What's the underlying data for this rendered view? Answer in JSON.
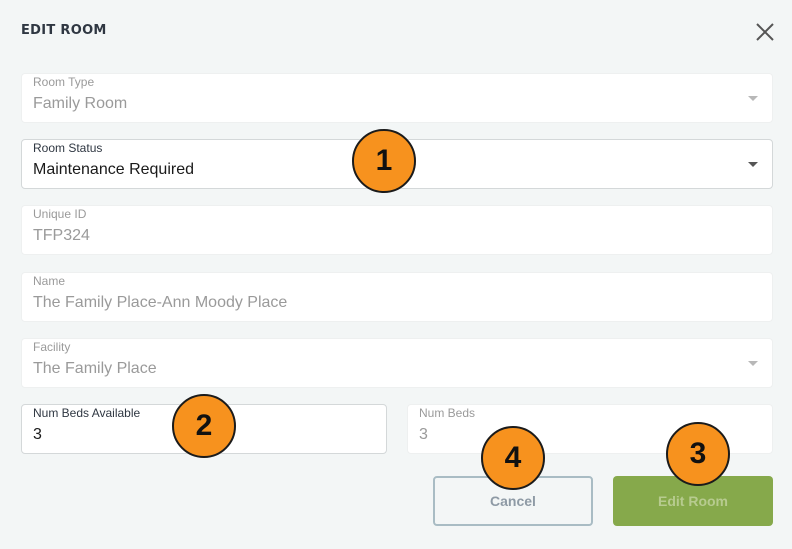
{
  "dialog": {
    "title": "EDIT ROOM",
    "close_icon": "close-icon"
  },
  "fields": {
    "room_type": {
      "label": "Room Type",
      "value": "Family Room"
    },
    "room_status": {
      "label": "Room Status",
      "value": "Maintenance Required"
    },
    "unique_id": {
      "label": "Unique ID",
      "value": "TFP324"
    },
    "name": {
      "label": "Name",
      "value": "The Family Place-Ann Moody Place"
    },
    "facility": {
      "label": "Facility",
      "value": "The Family Place"
    },
    "num_beds_available": {
      "label": "Num Beds Available",
      "value": "3"
    },
    "num_beds": {
      "label": "Num Beds",
      "value": "3"
    }
  },
  "buttons": {
    "cancel": "Cancel",
    "edit_room": "Edit Room"
  },
  "annotations": [
    "1",
    "2",
    "3",
    "4"
  ],
  "colors": {
    "accent_green": "#86a94b",
    "badge_orange": "#f7921e",
    "background": "#f3f6f6"
  }
}
